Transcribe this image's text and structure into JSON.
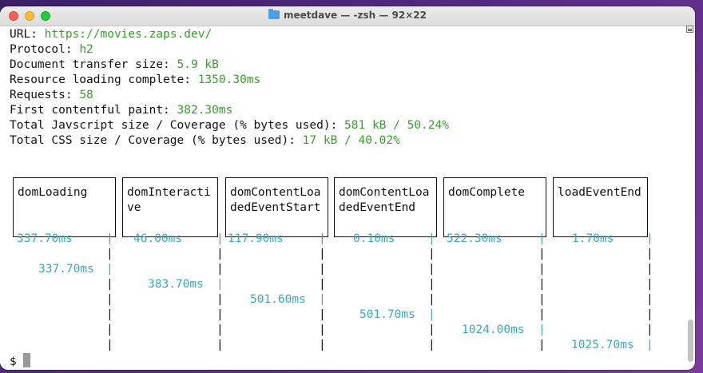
{
  "window": {
    "title": "meetdave — -zsh — 92×22"
  },
  "info": [
    {
      "label": "URL: ",
      "value": "https://movies.zaps.dev/"
    },
    {
      "label": "Protocol: ",
      "value": "h2"
    },
    {
      "label": "Document transfer size: ",
      "value": "5.9 kB"
    },
    {
      "label": "Resource loading complete: ",
      "value": "1350.30ms"
    },
    {
      "label": "Requests: ",
      "value": "58"
    },
    {
      "label": "First contentful paint: ",
      "value": "382.30ms"
    },
    {
      "label": "Total Javscript size / Coverage (% bytes used): ",
      "value": "581 kB / 50.24%"
    },
    {
      "label": "Total CSS size / Coverage (% bytes used): ",
      "value": "17 kB / 40.02%"
    }
  ],
  "timeline": {
    "columns": [
      {
        "name": "domLoading",
        "duration": "337.70ms",
        "end": "337.70ms"
      },
      {
        "name": "domInteractive",
        "duration": "46.00ms",
        "end": "383.70ms"
      },
      {
        "name": "domContentLoadedEventStart",
        "duration": "117.90ms",
        "end": "501.60ms"
      },
      {
        "name": "domContentLoadedEventEnd",
        "duration": "0.10ms",
        "end": "501.70ms"
      },
      {
        "name": "domComplete",
        "duration": "522.30ms",
        "end": "1024.00ms"
      },
      {
        "name": "loadEventEnd",
        "duration": "1.70ms",
        "end": "1025.70ms"
      }
    ],
    "separator": "|"
  },
  "prompt": {
    "symbol": "$"
  },
  "colors": {
    "green": "#3c9b30",
    "cyan": "#3aa7be"
  }
}
